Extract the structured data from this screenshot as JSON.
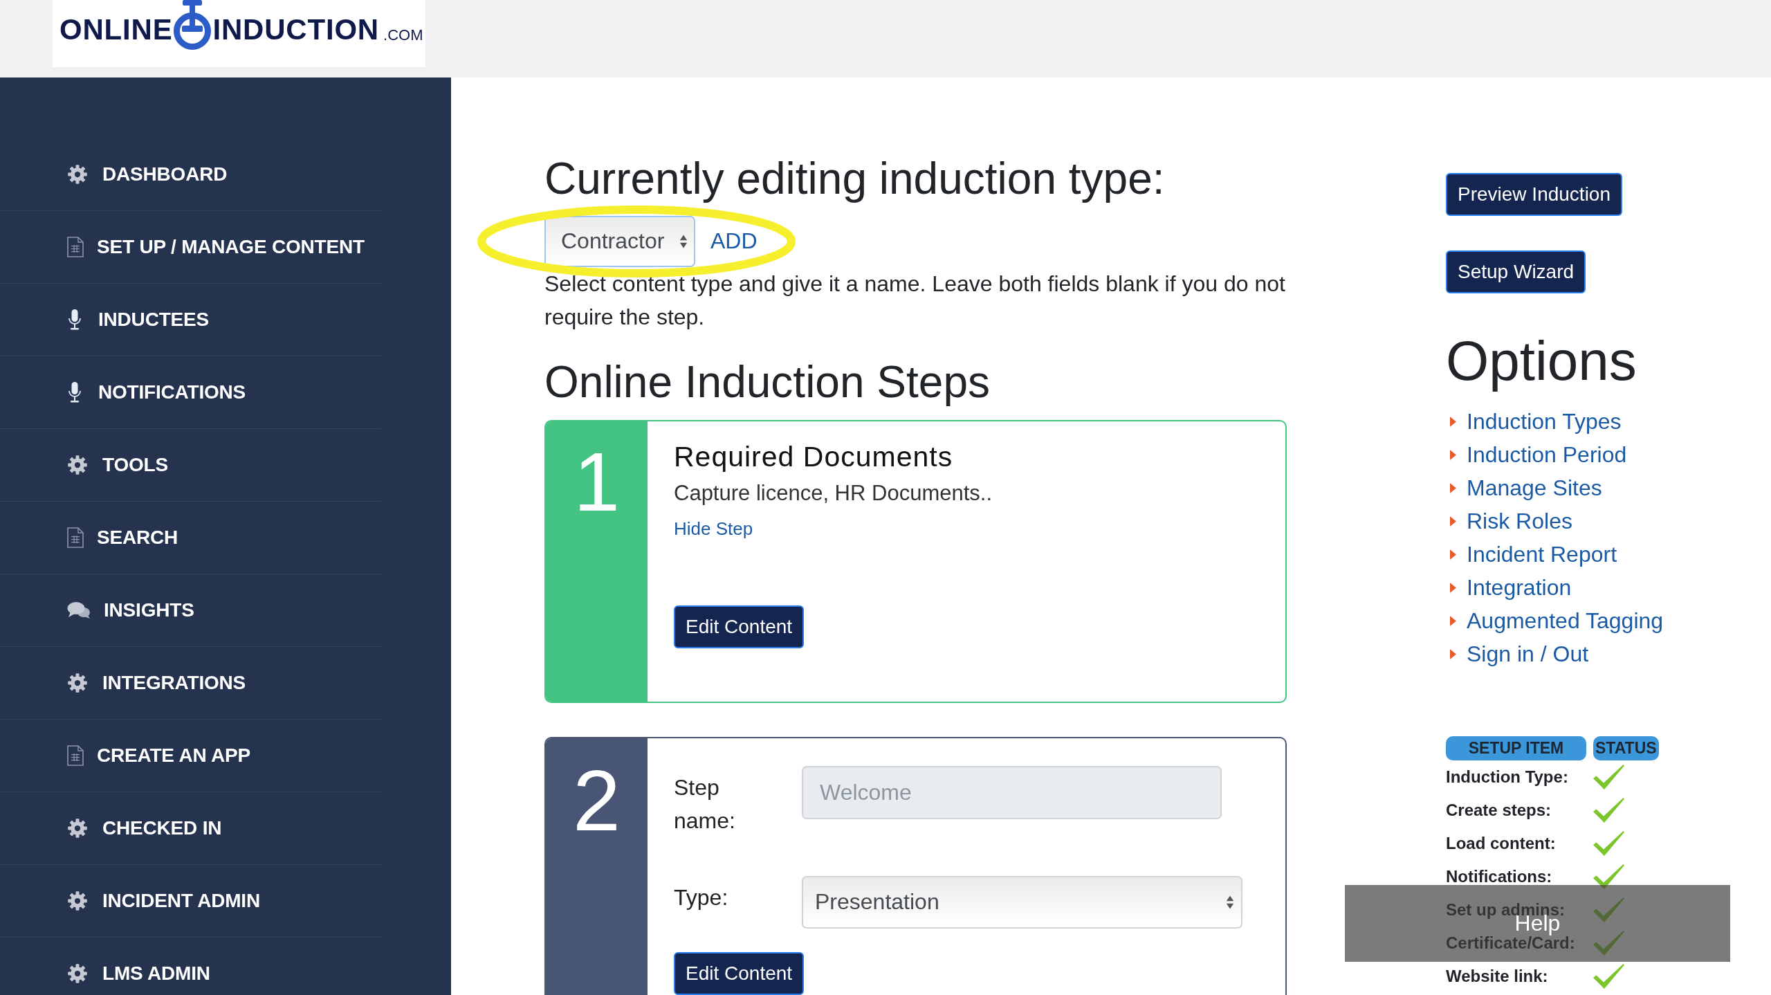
{
  "logo": {
    "left": "ONLINE",
    "right": "INDUCTION",
    "suffix": ".COM"
  },
  "sidebar": {
    "items": [
      {
        "kind": "gear",
        "label": "DASHBOARD",
        "selected": false
      },
      {
        "kind": "page",
        "label": "SET UP / MANAGE CONTENT",
        "selected": false
      },
      {
        "kind": "mic",
        "label": "INDUCTEES",
        "selected": false
      },
      {
        "kind": "mic",
        "label": "NOTIFICATIONS",
        "selected": false
      },
      {
        "kind": "gear",
        "label": "TOOLS",
        "selected": false
      },
      {
        "kind": "page",
        "label": "SEARCH",
        "selected": false
      },
      {
        "kind": "chat",
        "label": "INSIGHTS",
        "selected": false
      },
      {
        "kind": "gear",
        "label": "INTEGRATIONS",
        "selected": false
      },
      {
        "kind": "page",
        "label": "CREATE AN APP",
        "selected": false
      },
      {
        "kind": "gear",
        "label": "CHECKED IN",
        "selected": false
      },
      {
        "kind": "gear",
        "label": "INCIDENT ADMIN",
        "selected": false
      },
      {
        "kind": "gear",
        "label": "LMS ADMIN",
        "selected": false
      }
    ]
  },
  "editor": {
    "title": "Currently editing induction type:",
    "type_select": {
      "value": "Contractor"
    },
    "add_link": "ADD",
    "highlighted": true,
    "hint": "Select content type and give it a name. Leave both fields blank if you do not require the step."
  },
  "steps_heading": "Online Induction Steps",
  "steps": [
    {
      "kind": "summary",
      "number": "1",
      "color": "#43c483",
      "title": "Required Documents",
      "description": "Capture licence, HR Documents..",
      "link": "Hide Step",
      "button": "Edit Content"
    },
    {
      "kind": "form",
      "number": "2",
      "color": "#485574",
      "fields": [
        {
          "kind": "text",
          "label": "Step name:",
          "placeholder": "Welcome",
          "disabled": true
        },
        {
          "kind": "select",
          "label": "Type:",
          "value": "Presentation"
        }
      ],
      "button": "Edit Content"
    }
  ],
  "actions": [
    "Preview Induction",
    "Setup Wizard"
  ],
  "options": {
    "title": "Options",
    "links": [
      "Induction Types",
      "Induction Period",
      "Manage Sites",
      "Risk Roles",
      "Incident Report",
      "Integration",
      "Augmented Tagging",
      "Sign in / Out"
    ]
  },
  "setup_status": {
    "columns": [
      "SETUP ITEM",
      "STATUS"
    ],
    "rows": [
      {
        "item": "Induction Type:",
        "done": true
      },
      {
        "item": "Create steps:",
        "done": true
      },
      {
        "item": "Load content:",
        "done": true
      },
      {
        "item": "Notifications:",
        "done": true
      },
      {
        "item": "Set up admins:",
        "done": true
      },
      {
        "item": "Certificate/Card:",
        "done": true
      },
      {
        "item": "Website link:",
        "done": true
      }
    ]
  },
  "help_button": "Help"
}
